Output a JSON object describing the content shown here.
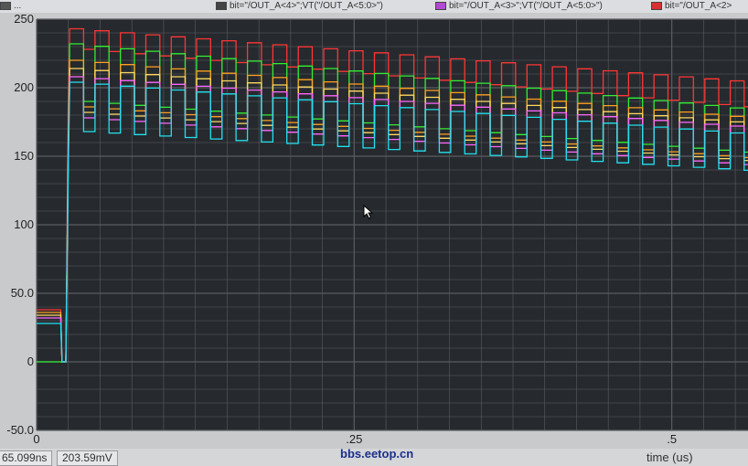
{
  "legend": [
    {
      "text": "...",
      "color": "#555555"
    },
    {
      "text": "bit=\"/OUT_A<4>\";VT(\"/OUT_A<5:0>\")",
      "color": "#444444"
    },
    {
      "text": "bit=\"/OUT_A<3>\";VT(\"/OUT_A<5:0>\")",
      "color": "#b04ad0"
    },
    {
      "text": "bit=\"/OUT_A<2>",
      "color": "#d83030"
    }
  ],
  "status": {
    "time_readout": "65.099ns",
    "value_readout": "203.59mV"
  },
  "watermark": "bbs.eetop.cn",
  "colors": {
    "plot_bg": "#262a2e",
    "grid": "#5a5d61",
    "axis_panel": "#c8cacc"
  },
  "chart_data": {
    "type": "line",
    "xlabel": "time (us)",
    "ylabel": "",
    "xlim": [
      0,
      0.56
    ],
    "ylim": [
      -50,
      250
    ],
    "yticks": [
      {
        "value": 250,
        "label": "250"
      },
      {
        "value": 200,
        "label": "200"
      },
      {
        "value": 150,
        "label": "150"
      },
      {
        "value": 100,
        "label": "100"
      },
      {
        "value": 50,
        "label": "50.0"
      },
      {
        "value": 0,
        "label": "0"
      },
      {
        "value": -50,
        "label": "-50.0"
      }
    ],
    "xticks": [
      {
        "value": 0,
        "label": "0"
      },
      {
        "value": 0.25,
        "label": ".25"
      },
      {
        "value": 0.5,
        "label": ".5"
      }
    ],
    "grid": true,
    "waveform": {
      "settle_time": 0.019,
      "pulse_start": 0.026,
      "period": 0.02,
      "high_fraction": 0.55
    },
    "series": [
      {
        "color": "#ff3535",
        "initial": 38,
        "high_start": 243,
        "high_end": 204,
        "low_start": 228,
        "low_end": 185
      },
      {
        "color": "#33ee33",
        "initial": 0,
        "high_start": 232,
        "high_end": 184,
        "low_start": 190,
        "low_end": 152
      },
      {
        "color": "#ffa020",
        "initial": 36,
        "high_start": 220,
        "high_end": 178,
        "low_start": 186,
        "low_end": 148
      },
      {
        "color": "#ffd860",
        "initial": 34,
        "high_start": 214,
        "high_end": 174,
        "low_start": 182,
        "low_end": 146
      },
      {
        "color": "#ff66ff",
        "initial": 32,
        "high_start": 208,
        "high_end": 171,
        "low_start": 178,
        "low_end": 143
      },
      {
        "color": "#22e0f0",
        "initial": 28,
        "high_start": 204,
        "high_end": 166,
        "low_start": 168,
        "low_end": 139
      }
    ]
  }
}
